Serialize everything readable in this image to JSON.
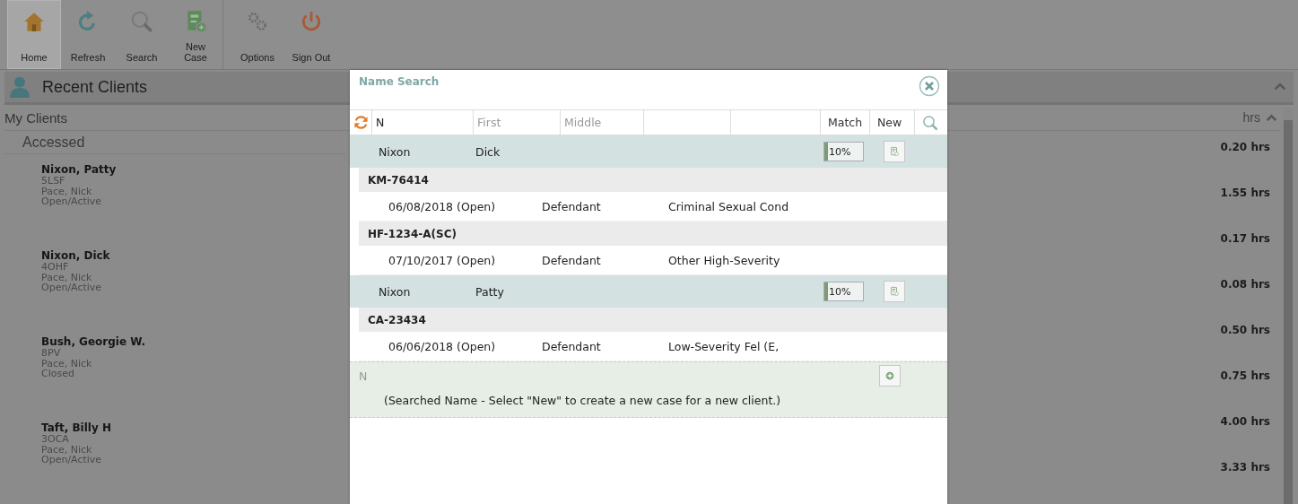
{
  "toolbar": {
    "groups": [
      [
        {
          "label": "Home",
          "kind": "home",
          "selected": true
        },
        {
          "label": "Refresh",
          "kind": "refresh",
          "selected": false
        },
        {
          "label": "Search",
          "kind": "search",
          "selected": false
        },
        {
          "label": "New Case",
          "kind": "newcase",
          "selected": false
        }
      ],
      [
        {
          "label": "Options",
          "kind": "options",
          "selected": false
        },
        {
          "label": "Sign Out",
          "kind": "signout",
          "selected": false
        }
      ]
    ]
  },
  "panel": {
    "title": "Recent Clients",
    "filter_label": "My Clients",
    "sort_label": "hrs",
    "group_label": "Accessed",
    "clients": [
      {
        "name": "Nixon, Patty",
        "code": "5LSF",
        "attorney": "Pace, Nick",
        "status": "Open/Active"
      },
      {
        "name": "Nixon, Dick",
        "code": "4OHF",
        "attorney": "Pace, Nick",
        "status": "Open/Active"
      },
      {
        "name": "Bush, Georgie W.",
        "code": "8PV",
        "attorney": "Pace, Nick",
        "status": "Closed"
      },
      {
        "name": "Taft, Billy H",
        "code": "3OCA",
        "attorney": "Pace, Nick",
        "status": "Open/Active"
      }
    ],
    "hours": [
      "0.20 hrs",
      "1.55 hrs",
      "0.17 hrs",
      "0.08 hrs",
      "0.50 hrs",
      "0.75 hrs",
      "4.00 hrs",
      "3.33 hrs"
    ]
  },
  "dialog": {
    "title": "Name Search",
    "search": {
      "last": "N",
      "first_placeholder": "First",
      "middle_placeholder": "Middle"
    },
    "columns": [
      "Match",
      "New"
    ],
    "results": [
      {
        "last": "Nixon",
        "first": "Dick",
        "match": "10%",
        "level": 0.1,
        "cases": [
          {
            "number": "KM-76414",
            "opened": "06/08/2018 (Open)",
            "role": "Defendant",
            "charge": "Criminal Sexual Cond"
          },
          {
            "number": "HF-1234-A(SC)",
            "opened": "07/10/2017 (Open)",
            "role": "Defendant",
            "charge": "Other High-Severity"
          }
        ]
      },
      {
        "last": "Nixon",
        "first": "Patty",
        "match": "10%",
        "level": 0.1,
        "cases": [
          {
            "number": "CA-23434",
            "opened": "06/06/2018 (Open)",
            "role": "Defendant",
            "charge": "Low-Severity Fel (E,"
          }
        ]
      }
    ],
    "new_entry": {
      "name": "N",
      "note": "(Searched Name - Select \"New\" to create a new case for a new client.)"
    }
  }
}
